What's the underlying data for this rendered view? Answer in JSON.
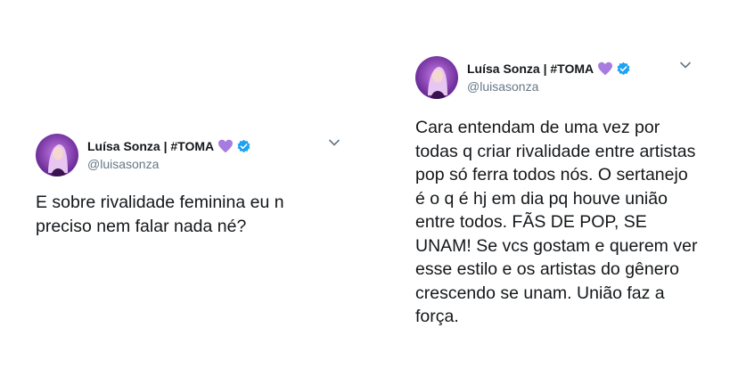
{
  "tweets": [
    {
      "display_name": "Luísa Sonza | #TOMA",
      "handle": "@luisasonza",
      "text": "E sobre rivalidade feminina eu n preciso nem falar nada né?",
      "icons": [
        "avatar",
        "purple-heart-icon",
        "verified-icon",
        "chevron-down-icon"
      ]
    },
    {
      "display_name": "Luísa Sonza | #TOMA",
      "handle": "@luisasonza",
      "text": "Cara entendam de uma vez por todas q criar rivalidade entre artistas pop só ferra todos nós. O sertanejo é o q é hj em dia pq houve união entre todos. FÃS DE POP, SE UNAM! Se vcs gostam e querem ver esse estilo e os artistas do gênero crescendo se unam. União faz a força.",
      "icons": [
        "avatar",
        "purple-heart-icon",
        "verified-icon",
        "chevron-down-icon"
      ]
    }
  ],
  "colors": {
    "text": "#14171a",
    "handle": "#657786",
    "verified": "#1da1f2",
    "heart": "#a77ce0",
    "avatar_bg": "#7b3aa8"
  }
}
